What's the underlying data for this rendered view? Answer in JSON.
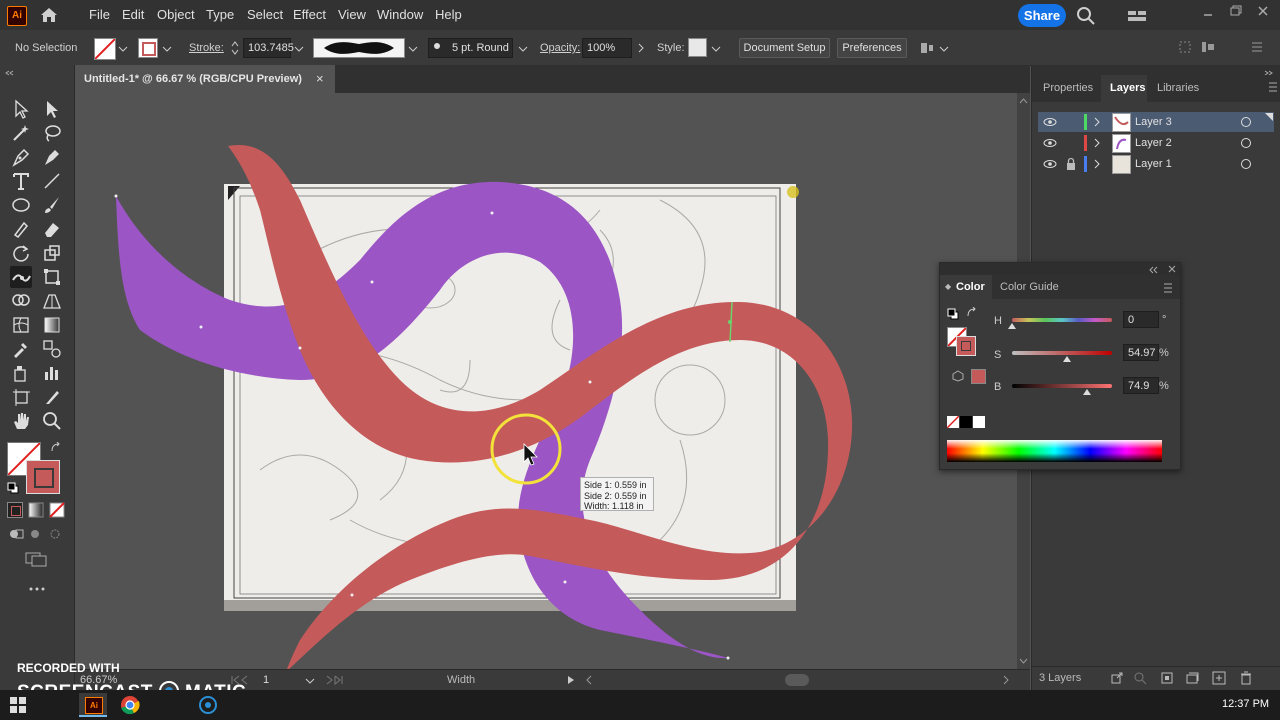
{
  "app": {
    "logo": "Ai"
  },
  "menu": [
    "File",
    "Edit",
    "Object",
    "Type",
    "Select",
    "Effect",
    "View",
    "Window",
    "Help"
  ],
  "header": {
    "share_label": "Share"
  },
  "control_bar": {
    "selection": "No Selection",
    "stroke_label": "Stroke:",
    "stroke_value": "103.7485",
    "brush_label": "5 pt. Round",
    "opacity_label": "Opacity:",
    "opacity_value": "100%",
    "style_label": "Style:",
    "document_setup": "Document Setup",
    "preferences": "Preferences"
  },
  "document": {
    "tab_title": "Untitled-1* @ 66.67 % (RGB/CPU Preview)",
    "close": "×"
  },
  "status": {
    "zoom": "66.67%",
    "artboard": "1",
    "tool": "Width"
  },
  "layers_panel": {
    "tabs": [
      "Properties",
      "Layers",
      "Libraries"
    ],
    "active_tab": "Layers",
    "layers": [
      {
        "name": "Layer 3",
        "color": "#4cd964",
        "locked": false,
        "selected": true
      },
      {
        "name": "Layer 2",
        "color": "#e04848",
        "locked": false,
        "selected": false
      },
      {
        "name": "Layer 1",
        "color": "#4a7ef0",
        "locked": true,
        "selected": false
      }
    ],
    "count": "3 Layers"
  },
  "color_panel": {
    "tabs": [
      "Color",
      "Color Guide"
    ],
    "h_label": "H",
    "h_value": "0",
    "h_unit": "°",
    "s_label": "S",
    "s_value": "54.97",
    "s_unit": "%",
    "b_label": "B",
    "b_value": "74.9",
    "b_unit": "%",
    "fill_color": "#c55a5a",
    "h_level": 0.0,
    "s_level": 0.5497,
    "b_level": 0.749
  },
  "tooltip": {
    "line1": "Side 1: 0.559 in",
    "line2": "Side 2: 0.559 in",
    "line3": "Width:  1.118 in"
  },
  "watermark": {
    "line1": "RECORDED WITH",
    "line2a": "SCREENCAST",
    "line2b": "MATIC"
  },
  "taskbar": {
    "time": "12:37 PM"
  },
  "colors": {
    "red_stroke": "#c55a5a",
    "purple_stroke": "#9b55c5",
    "accent": "#1473e6"
  }
}
